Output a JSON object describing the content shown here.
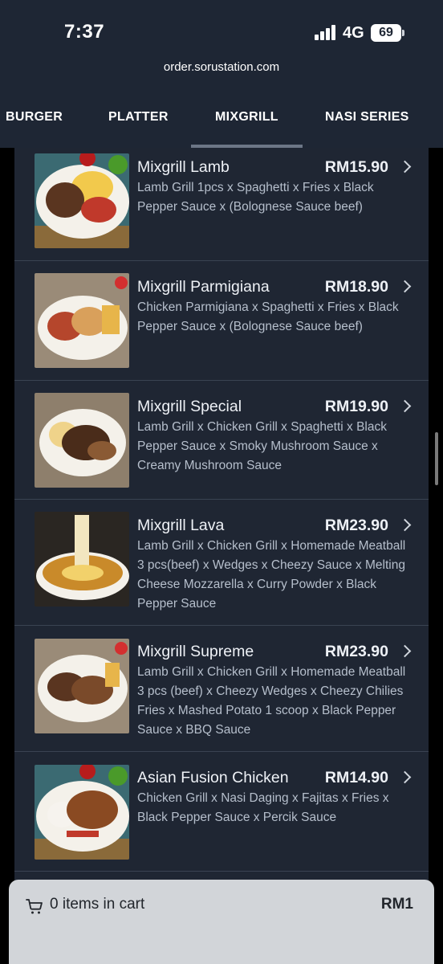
{
  "status_bar": {
    "time": "7:37",
    "network": "4G",
    "battery": "69"
  },
  "browser": {
    "url": "order.sorustation.com"
  },
  "tabs": [
    {
      "label": "BURGER"
    },
    {
      "label": "PLATTER"
    },
    {
      "label": "MIXGRILL",
      "active": true
    },
    {
      "label": "NASI SERIES"
    }
  ],
  "menu_items": [
    {
      "name": "Mixgrill Lamb",
      "price": "RM15.90",
      "description": "Lamb Grill 1pcs x Spaghetti x Fries x Black Pepper Sauce x (Bolognese Sauce beef)"
    },
    {
      "name": "Mixgrill Parmigiana",
      "price": "RM18.90",
      "description": "Chicken Parmigiana x Spaghetti x Fries x Black Pepper Sauce x (Bolognese Sauce beef)"
    },
    {
      "name": "Mixgrill Special",
      "price": "RM19.90",
      "description": "Lamb Grill x Chicken Grill x Spaghetti x Black Pepper Sauce x Smoky Mushroom Sauce x Creamy Mushroom Sauce"
    },
    {
      "name": "Mixgrill Lava",
      "price": "RM23.90",
      "description": "Lamb Grill x Chicken Grill x Homemade Meatball 3 pcs(beef) x Wedges x Cheezy Sauce x Melting Cheese Mozzarella x Curry Powder x Black Pepper Sauce"
    },
    {
      "name": "Mixgrill Supreme",
      "price": "RM23.90",
      "description": "Lamb Grill x Chicken Grill x Homemade Meatball 3 pcs (beef) x Cheezy Wedges x Cheezy Chilies Fries x Mashed Potato 1 scoop x Black Pepper Sauce x BBQ Sauce"
    },
    {
      "name": "Asian Fusion Chicken",
      "price": "RM14.90",
      "description": "Chicken Grill x Nasi Daging x Fajitas x Fries x Black Pepper Sauce x Percik Sauce"
    }
  ],
  "cart": {
    "count_text": "0 items in cart",
    "total": "RM1"
  },
  "colors": {
    "background": "#1f2633",
    "header": "#1e2634",
    "cart_bar": "#d2d5d9",
    "divider": "#3a4352"
  }
}
